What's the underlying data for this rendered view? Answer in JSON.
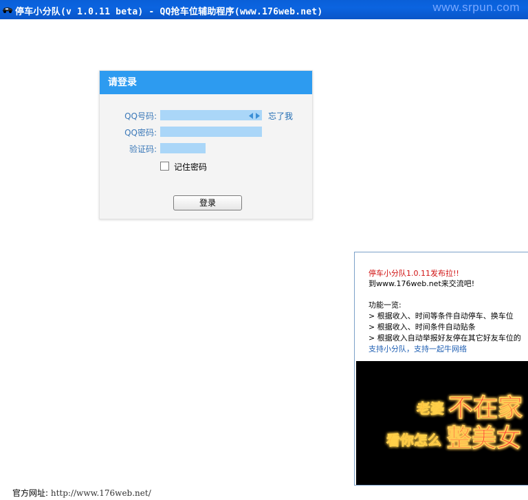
{
  "window": {
    "title": "停车小分队(v 1.0.11 beta) - QQ抢车位辅助程序(www.176web.net)",
    "watermark": "www.srpun.com"
  },
  "login": {
    "header": "请登录",
    "qq_label": "QQ号码:",
    "password_label": "QQ密码:",
    "captcha_label": "验证码:",
    "forgot_link": "忘了我",
    "remember_label": "记住密码",
    "remember_checked": false,
    "login_button": "登录"
  },
  "info": {
    "announce": "停车小分队1.0.11发布拉!!",
    "visit": "到www.176web.net来交流吧!",
    "features_title": "功能一览:",
    "features": [
      "> 根据收入、时间等条件自动停车、换车位",
      "> 根据收入、时间条件自动贴条",
      "> 根据收入自动举报好友停在其它好友车位的"
    ],
    "support": "支持小分队，支持一起牛网络",
    "banner_line1_small": "老婆",
    "banner_line1_big": "不在家",
    "banner_line2_small": "看你怎么",
    "banner_line2_big": "整美女"
  },
  "footer": {
    "label": "官方网址:",
    "url": "http://www.176web.net/"
  }
}
